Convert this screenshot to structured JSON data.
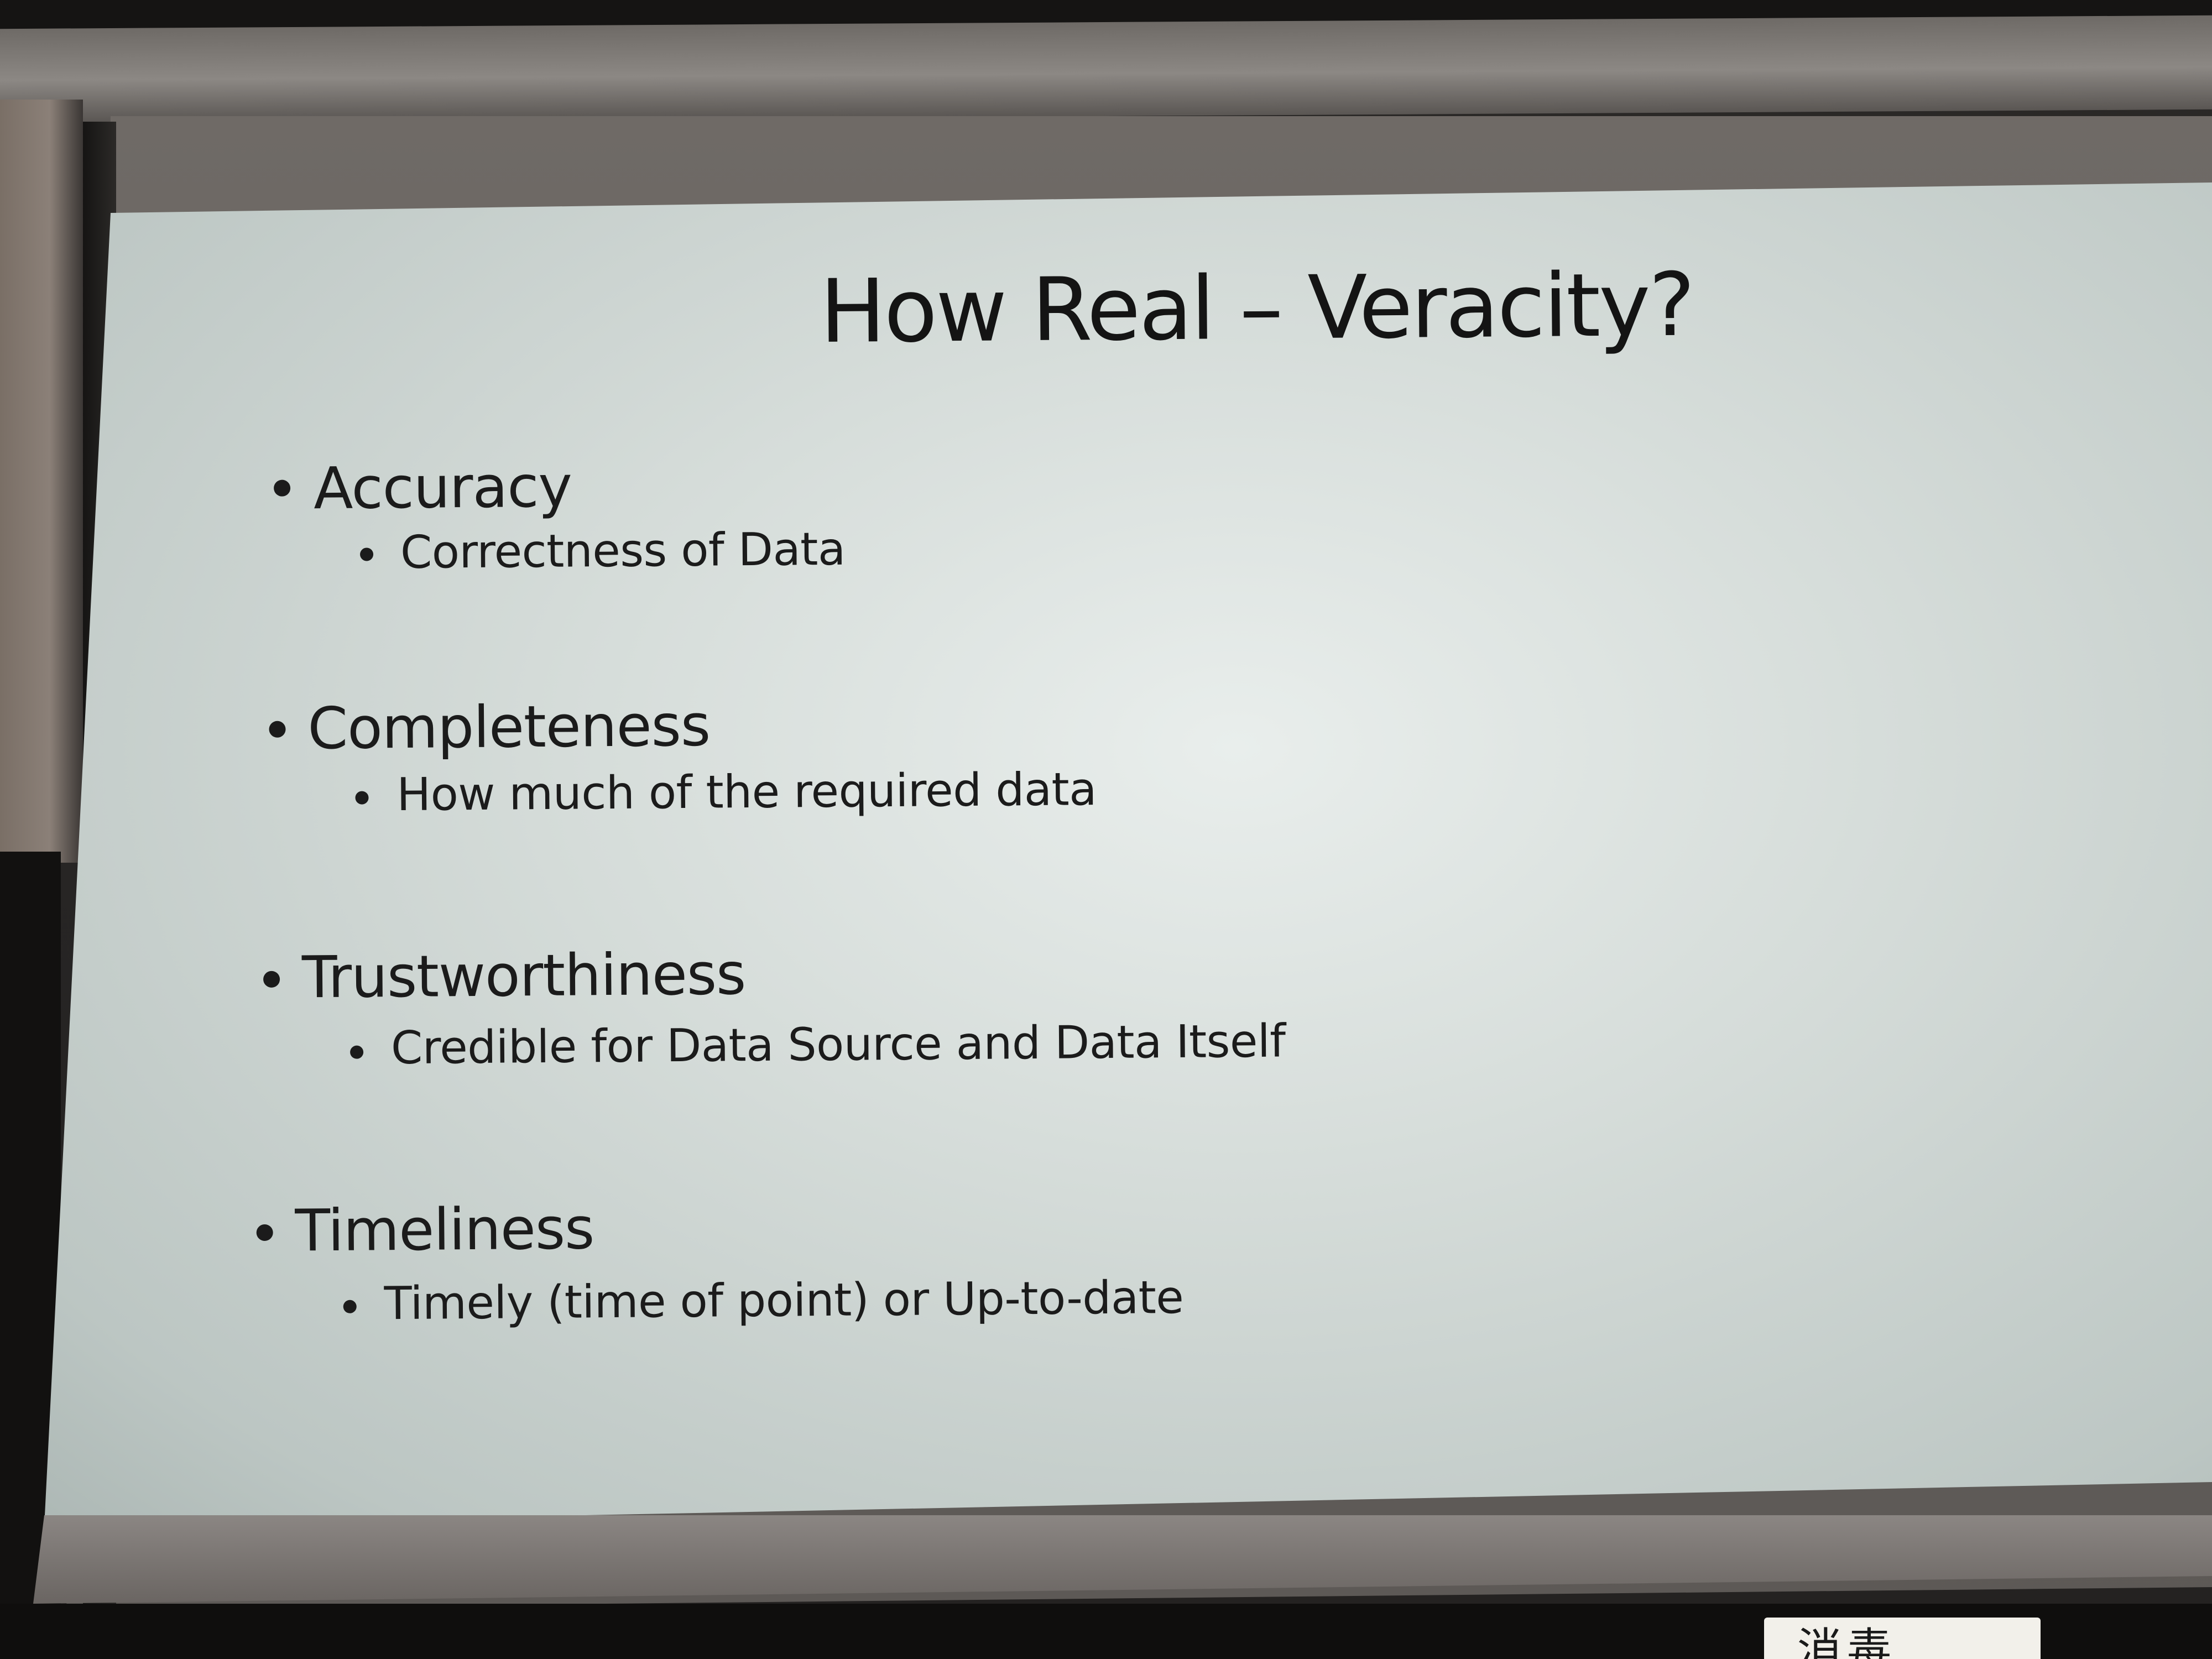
{
  "slide": {
    "title": "How Real – Veracity?",
    "items": [
      {
        "heading": "Accuracy",
        "detail": "Correctness of Data"
      },
      {
        "heading": "Completeness",
        "detail": "How much of the required data"
      },
      {
        "heading": "Trustworthiness",
        "detail": "Credible for Data Source and Data Itself"
      },
      {
        "heading": "Timeliness",
        "detail": "Timely (time of point) or Up-to-date"
      }
    ]
  },
  "corner_label": {
    "text": "消毒"
  },
  "colors": {
    "slide_background": "#d5dcd9",
    "text": "#1b1b1b",
    "room": "#1e1c1b"
  }
}
